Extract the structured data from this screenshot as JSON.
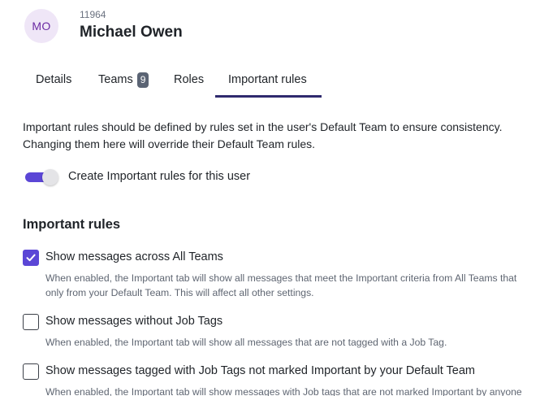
{
  "user": {
    "initials": "MO",
    "id": "11964",
    "name": "Michael Owen"
  },
  "tabs": [
    {
      "label": "Details",
      "active": false
    },
    {
      "label": "Teams",
      "badge": "9",
      "active": false
    },
    {
      "label": "Roles",
      "active": false
    },
    {
      "label": "Important rules",
      "active": true
    }
  ],
  "intro": {
    "line1": "Important rules should be defined by rules set in the user's Default Team to ensure consistency.",
    "line2": "Changing them here will override their Default Team rules."
  },
  "toggle": {
    "label": "Create Important rules for this user",
    "on": true
  },
  "section": {
    "title": "Important rules"
  },
  "rules": [
    {
      "label": "Show messages across All Teams",
      "checked": true,
      "desc1": "When enabled, the Important tab will show all messages that meet the Important criteria from All Teams that",
      "desc2": "only from your Default Team. This will affect all other settings."
    },
    {
      "label": "Show messages without Job Tags",
      "checked": false,
      "desc1": "When enabled, the Important tab will show all messages that are not tagged with a Job Tag."
    },
    {
      "label": "Show messages tagged with Job Tags not marked Important by your Default Team",
      "checked": false,
      "desc1": "When enabled, the Important tab will show messages with Job tags that are not marked Important by anyone"
    }
  ],
  "colors": {
    "accent": "#5b46d6",
    "active_tab_underline": "#2f2a6e",
    "avatar_bg": "#efe6f7",
    "avatar_text": "#6b2aa3",
    "badge_bg": "#5b6474"
  }
}
